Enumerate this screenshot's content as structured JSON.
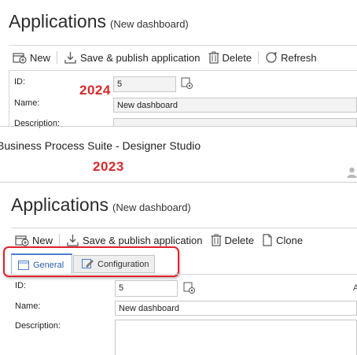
{
  "v2024": {
    "year": "2024",
    "title": "Applications",
    "subtitle": "(New dashboard)",
    "toolbar": {
      "new": "New",
      "save_publish": "Save & publish application",
      "delete": "Delete",
      "refresh": "Refresh"
    },
    "fields": {
      "id_label": "ID:",
      "id_value": "5",
      "name_label": "Name:",
      "name_value": "New dashboard",
      "description_label": "Description:"
    }
  },
  "v2023": {
    "window_title": "Business Process Suite - Designer Studio",
    "year": "2023",
    "title": "Applications",
    "subtitle": "(New dashboard)",
    "toolbar": {
      "new": "New",
      "save_publish": "Save & publish application",
      "delete": "Delete",
      "clone": "Clone"
    },
    "tabs": [
      {
        "label": "General",
        "active": true
      },
      {
        "label": "Configuration",
        "active": false
      }
    ],
    "fields": {
      "id_label": "ID:",
      "id_value": "5",
      "name_label": "Name:",
      "name_value": "New dashboard",
      "description_label": "Description:"
    }
  },
  "colors": {
    "year_label": "#d42a2a",
    "highlight_border": "#e0202a",
    "tab_text": "#2a5fa8"
  }
}
